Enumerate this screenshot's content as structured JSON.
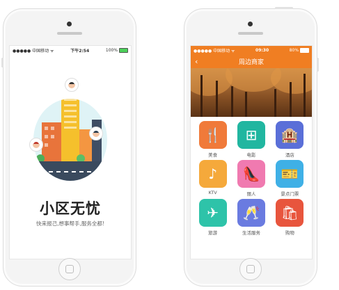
{
  "left_phone": {
    "status": {
      "carrier": "●●●●● 中国移动 ᯤ",
      "time": "下午2:54",
      "battery": "100%"
    },
    "title": "小区无忧",
    "subtitle": "快来报己,想事帮手,服务全都!"
  },
  "right_phone": {
    "status": {
      "carrier": "●●●●● 中国移动 ᯤ",
      "time": "09:30",
      "battery": "80%"
    },
    "nav": {
      "back": "‹",
      "title": "周边商家"
    },
    "categories": [
      {
        "label": "美食",
        "icon": "cutlery-icon",
        "glyph": "🍴",
        "color": "#f07a3a"
      },
      {
        "label": "电影",
        "icon": "film-reel-icon",
        "glyph": "⊞",
        "color": "#21b6a0"
      },
      {
        "label": "酒店",
        "icon": "hotel-icon",
        "glyph": "🏨",
        "color": "#5a6fd8"
      },
      {
        "label": "KTV",
        "icon": "music-note-icon",
        "glyph": "♪",
        "color": "#f5a93b"
      },
      {
        "label": "丽人",
        "icon": "high-heel-icon",
        "glyph": "👠",
        "color": "#f07ab0"
      },
      {
        "label": "景点门票",
        "icon": "ticket-icon",
        "glyph": "🎫",
        "color": "#3fb0e6"
      },
      {
        "label": "旅游",
        "icon": "airplane-icon",
        "glyph": "✈",
        "color": "#2ec3a9"
      },
      {
        "label": "生活服务",
        "icon": "wine-glasses-icon",
        "glyph": "🥂",
        "color": "#6a7be0"
      },
      {
        "label": "购物",
        "icon": "shopping-bag-icon",
        "glyph": "🛍",
        "color": "#e8553d"
      }
    ]
  }
}
